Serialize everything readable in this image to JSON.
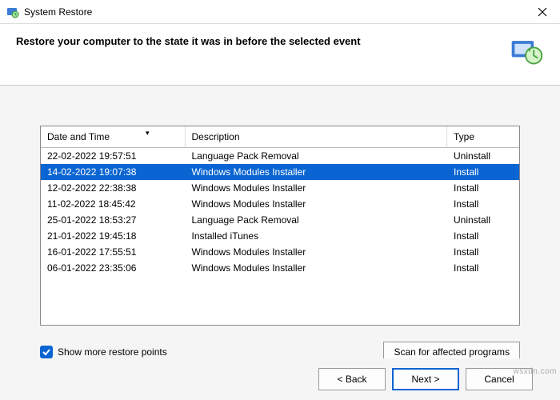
{
  "titlebar": {
    "title": "System Restore"
  },
  "header": {
    "headline": "Restore your computer to the state it was in before the selected event"
  },
  "columns": {
    "date": "Date and Time",
    "desc": "Description",
    "type": "Type"
  },
  "rows": [
    {
      "date": "22-02-2022 19:57:51",
      "desc": "Language Pack Removal",
      "type": "Uninstall",
      "selected": false
    },
    {
      "date": "14-02-2022 19:07:38",
      "desc": "Windows Modules Installer",
      "type": "Install",
      "selected": true
    },
    {
      "date": "12-02-2022 22:38:38",
      "desc": "Windows Modules Installer",
      "type": "Install",
      "selected": false
    },
    {
      "date": "11-02-2022 18:45:42",
      "desc": "Windows Modules Installer",
      "type": "Install",
      "selected": false
    },
    {
      "date": "25-01-2022 18:53:27",
      "desc": "Language Pack Removal",
      "type": "Uninstall",
      "selected": false
    },
    {
      "date": "21-01-2022 19:45:18",
      "desc": "Installed iTunes",
      "type": "Install",
      "selected": false
    },
    {
      "date": "16-01-2022 17:55:51",
      "desc": "Windows Modules Installer",
      "type": "Install",
      "selected": false
    },
    {
      "date": "06-01-2022 23:35:06",
      "desc": "Windows Modules Installer",
      "type": "Install",
      "selected": false
    }
  ],
  "checkbox": {
    "label": "Show more restore points",
    "checked": true
  },
  "buttons": {
    "scan": "Scan for affected programs",
    "back": "< Back",
    "next": "Next >",
    "cancel": "Cancel"
  },
  "watermark": "wsxdn.com"
}
